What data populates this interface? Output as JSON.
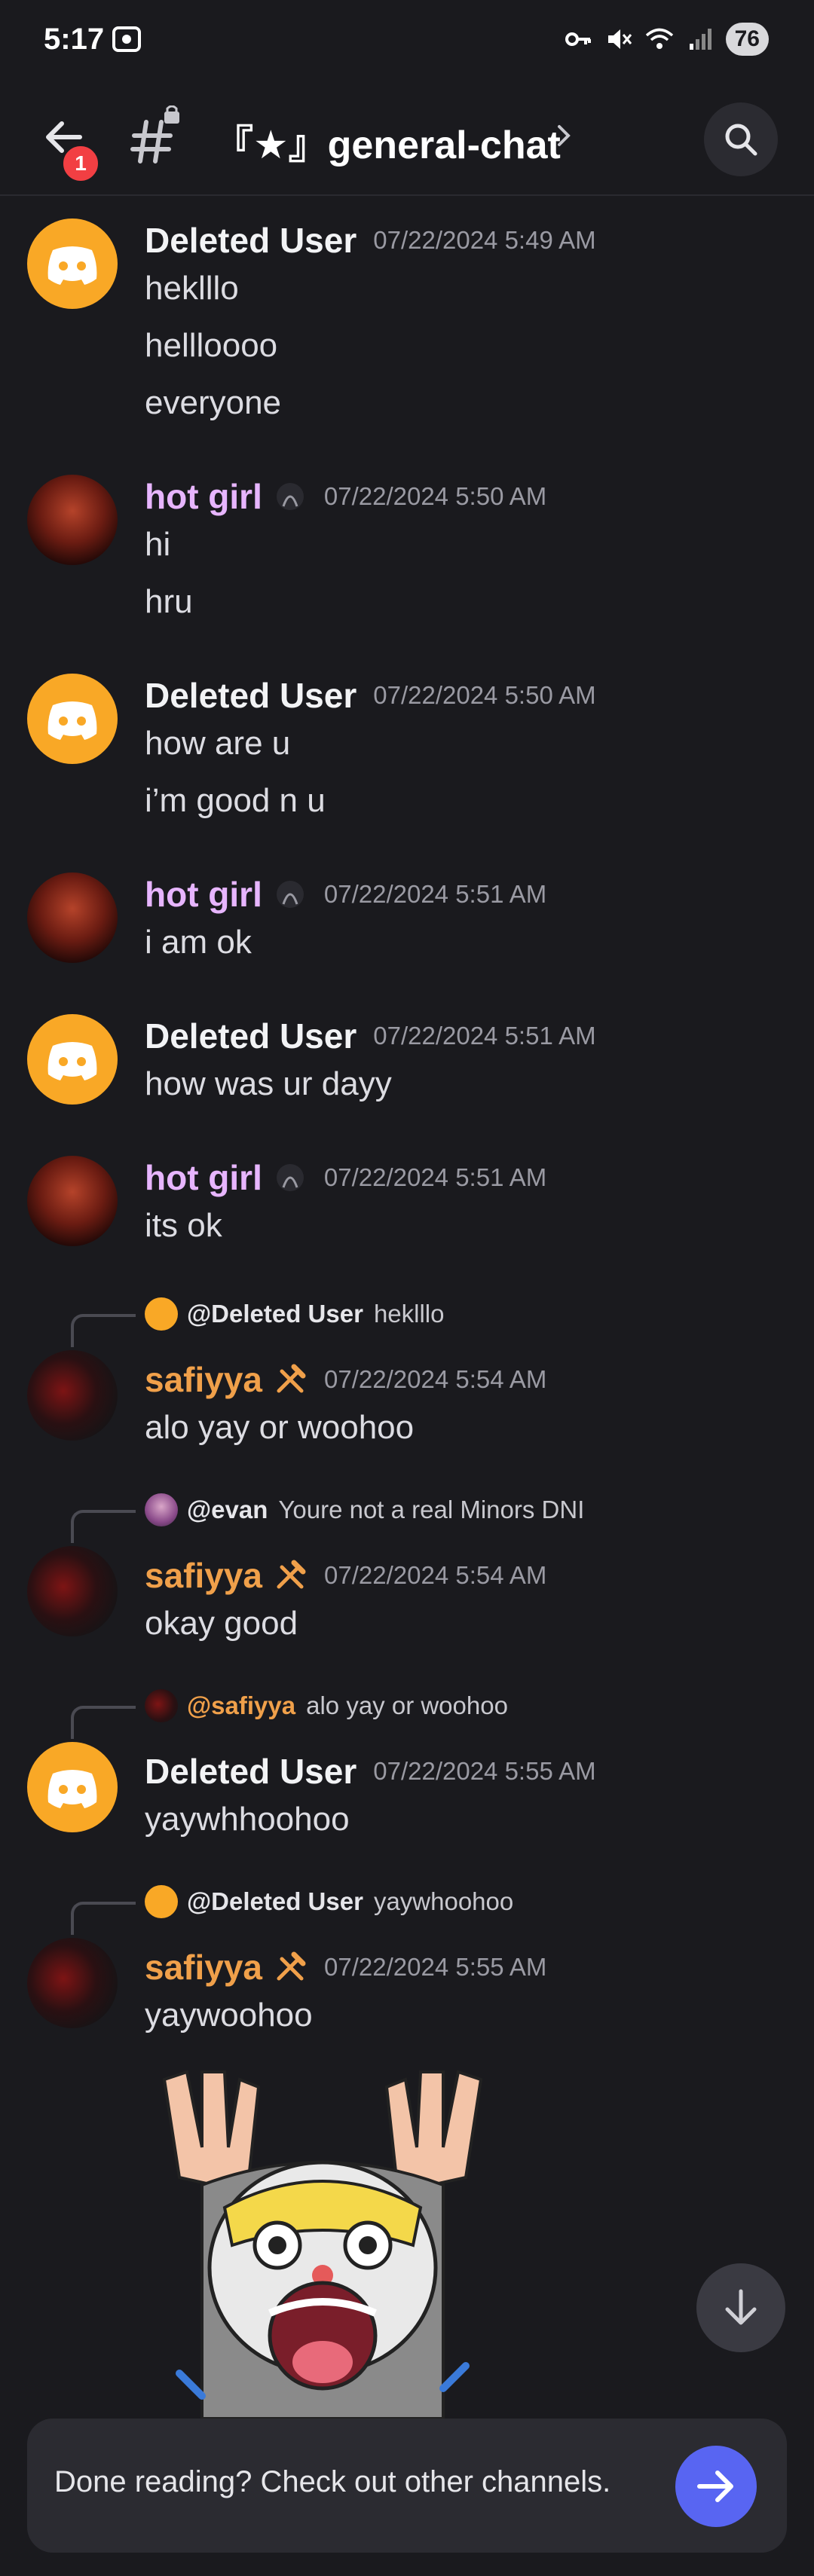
{
  "status_bar": {
    "time": "5:17",
    "battery": "76"
  },
  "header": {
    "notification_count": "1",
    "channel_name": "『★』general-chat"
  },
  "messages": [
    {
      "author": "Deleted User",
      "timestamp": "07/22/2024 5:49 AM",
      "lines": [
        "heklllo",
        "hellloooo",
        "everyone"
      ]
    },
    {
      "author": "hot girl",
      "timestamp": "07/22/2024 5:50 AM",
      "lines": [
        "hi",
        "hru"
      ]
    },
    {
      "author": "Deleted User",
      "timestamp": "07/22/2024 5:50 AM",
      "lines": [
        "how are u",
        "i’m good n u"
      ]
    },
    {
      "author": "hot girl",
      "timestamp": "07/22/2024 5:51 AM",
      "lines": [
        "i am ok"
      ]
    },
    {
      "author": "Deleted User",
      "timestamp": "07/22/2024 5:51 AM",
      "lines": [
        "how was ur dayy"
      ]
    },
    {
      "author": "hot girl",
      "timestamp": "07/22/2024 5:51 AM",
      "lines": [
        "its ok"
      ]
    },
    {
      "author": "safiyya",
      "timestamp": "07/22/2024 5:54 AM",
      "lines": [
        "alo yay or woohoo"
      ],
      "reply": {
        "name": "@Deleted User",
        "text": "heklllo"
      }
    },
    {
      "author": "safiyya",
      "timestamp": "07/22/2024 5:54 AM",
      "lines": [
        "okay good"
      ],
      "reply": {
        "name": "@evan",
        "text": "Youre not a real Minors DNI"
      }
    },
    {
      "author": "Deleted User",
      "timestamp": "07/22/2024 5:55 AM",
      "lines": [
        "yaywhhoohoo"
      ],
      "reply": {
        "name": "@safiyya",
        "text": "alo yay or woohoo"
      }
    },
    {
      "author": "safiyya",
      "timestamp": "07/22/2024 5:55 AM",
      "lines": [
        "yaywoohoo"
      ],
      "reply": {
        "name": "@Deleted User",
        "text": "yaywhoohoo"
      }
    }
  ],
  "bottom_bar": {
    "text": "Done reading? Check out other channels."
  },
  "colors": {
    "background": "#1a1a1e",
    "accent": "#5865f2",
    "discord_avatar": "#f9a826",
    "pink_name": "#e7b5ff",
    "orange_name": "#f0a04a",
    "badge": "#f23f43"
  },
  "icons": [
    "back-arrow-icon",
    "threads-hash-icon",
    "chevron-right-icon",
    "search-icon",
    "discord-logo-icon",
    "hammer-pick-icon",
    "arrow-down-icon",
    "arrow-right-icon"
  ]
}
